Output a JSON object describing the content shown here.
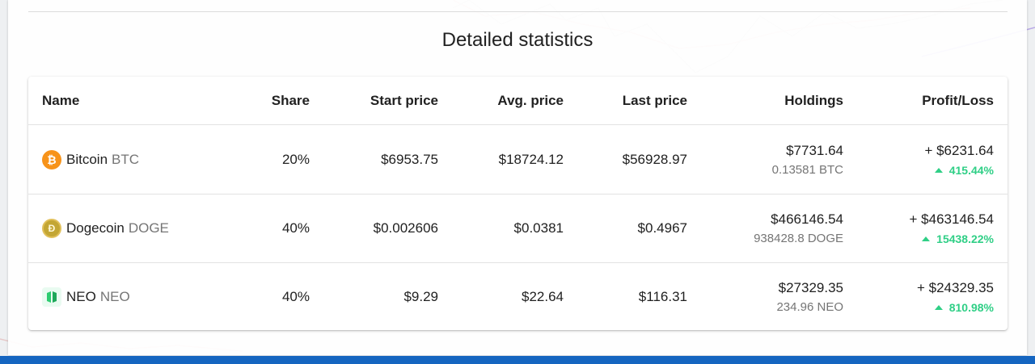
{
  "section": {
    "title": "Detailed statistics"
  },
  "table": {
    "headers": {
      "name": "Name",
      "share": "Share",
      "start_price": "Start price",
      "avg_price": "Avg. price",
      "last_price": "Last price",
      "holdings": "Holdings",
      "profit_loss": "Profit/Loss"
    },
    "rows": [
      {
        "name": "Bitcoin",
        "symbol": "BTC",
        "icon": "bitcoin-icon",
        "share": "20%",
        "start_price": "$6953.75",
        "avg_price": "$18724.12",
        "last_price": "$56928.97",
        "holdings_value": "$7731.64",
        "holdings_amount": "0.13581 BTC",
        "profit": "+ $6231.64",
        "profit_pct": "415.44%"
      },
      {
        "name": "Dogecoin",
        "symbol": "DOGE",
        "icon": "dogecoin-icon",
        "share": "40%",
        "start_price": "$0.002606",
        "avg_price": "$0.0381",
        "last_price": "$0.4967",
        "holdings_value": "$466146.54",
        "holdings_amount": "938428.8 DOGE",
        "profit": "+ $463146.54",
        "profit_pct": "15438.22%"
      },
      {
        "name": "NEO",
        "symbol": "NEO",
        "icon": "neo-icon",
        "share": "40%",
        "start_price": "$9.29",
        "avg_price": "$22.64",
        "last_price": "$116.31",
        "holdings_value": "$27329.35",
        "holdings_amount": "234.96 NEO",
        "profit": "+ $24329.35",
        "profit_pct": "810.98%"
      }
    ]
  },
  "colors": {
    "gain": "#2fcf86",
    "bottom_bar": "#1565c0",
    "btc": "#f7931a",
    "doge": "#c3a634",
    "neo": "#2ecc71"
  }
}
